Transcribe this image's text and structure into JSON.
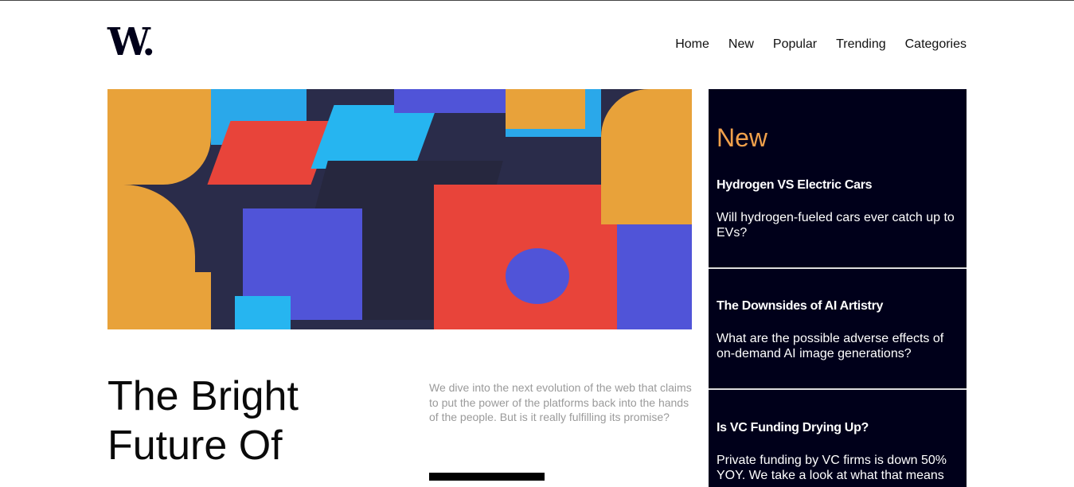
{
  "logo": "W.",
  "nav": [
    "Home",
    "New",
    "Popular",
    "Trending",
    "Categories"
  ],
  "hero": {
    "image": "abstract-3d-blocks",
    "title_lines": [
      "The Bright",
      "Future Of"
    ],
    "description": "We dive into the next evolution of the web that claims to put the power of the platforms back into the hands of the people. But is it really fulfilling its promise?"
  },
  "sidebar": {
    "heading": "New",
    "items": [
      {
        "title": "Hydrogen VS Electric Cars",
        "text": "Will hydrogen-fueled cars ever catch up to EVs?"
      },
      {
        "title": "The Downsides of AI Artistry",
        "text": "What are the possible adverse effects of on-demand AI image generations?"
      },
      {
        "title": "Is VC Funding Drying Up?",
        "text": "Private funding by VC firms is down 50% YOY. We take a look at what that means"
      }
    ]
  },
  "colors": {
    "accent": "#f0a04b",
    "sidebar_bg": "#00001a"
  }
}
